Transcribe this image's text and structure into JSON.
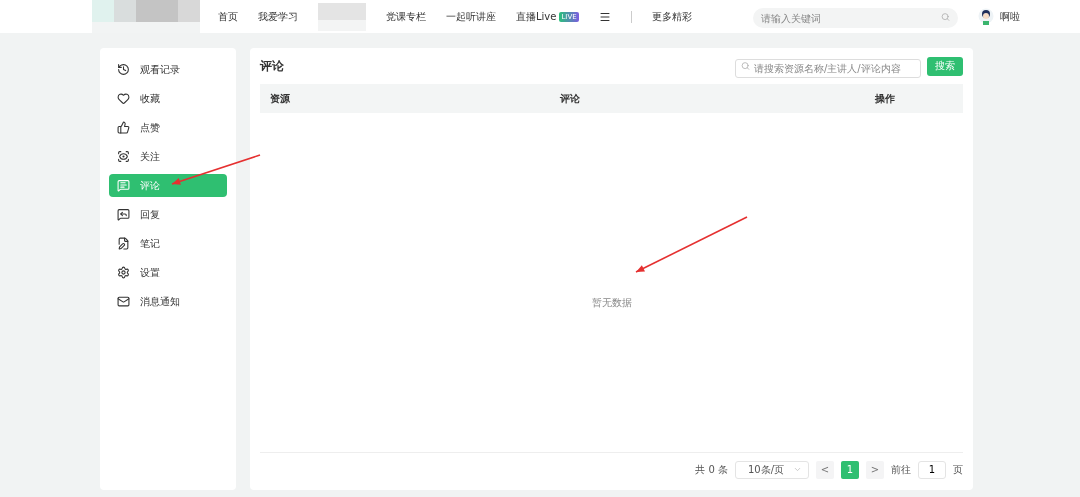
{
  "nav": {
    "items": [
      {
        "label": "首页"
      },
      {
        "label": "我爱学习"
      },
      {
        "kind": "redacted"
      },
      {
        "label": "党课专栏"
      },
      {
        "label": "一起听讲座"
      },
      {
        "label": "直播Live",
        "badge": "LIVE"
      }
    ],
    "more": "更多精彩"
  },
  "search": {
    "placeholder": "请输入关键词"
  },
  "user": {
    "name": "啊啦"
  },
  "sidebar": {
    "items": [
      {
        "label": "观看记录",
        "selected": false
      },
      {
        "label": "收藏",
        "selected": false
      },
      {
        "label": "点赞",
        "selected": false
      },
      {
        "label": "关注",
        "selected": false
      },
      {
        "label": "评论",
        "selected": true
      },
      {
        "label": "回复",
        "selected": false
      },
      {
        "label": "笔记",
        "selected": false
      },
      {
        "label": "设置",
        "selected": false
      },
      {
        "label": "消息通知",
        "selected": false
      }
    ]
  },
  "panel": {
    "title": "评论",
    "search": {
      "placeholder": "请搜索资源名称/主讲人/评论内容"
    },
    "search_button": "搜索",
    "table": {
      "columns": [
        "资源",
        "评论",
        "操作"
      ],
      "empty": "暂无数据"
    },
    "pagination": {
      "total": "共 0 条",
      "page_size": "10条/页",
      "prev": "<",
      "next": ">",
      "pages": [
        {
          "label": "1",
          "selected": true
        }
      ],
      "goto": "前往",
      "goto_value": "1",
      "goto_suffix": "页"
    }
  }
}
